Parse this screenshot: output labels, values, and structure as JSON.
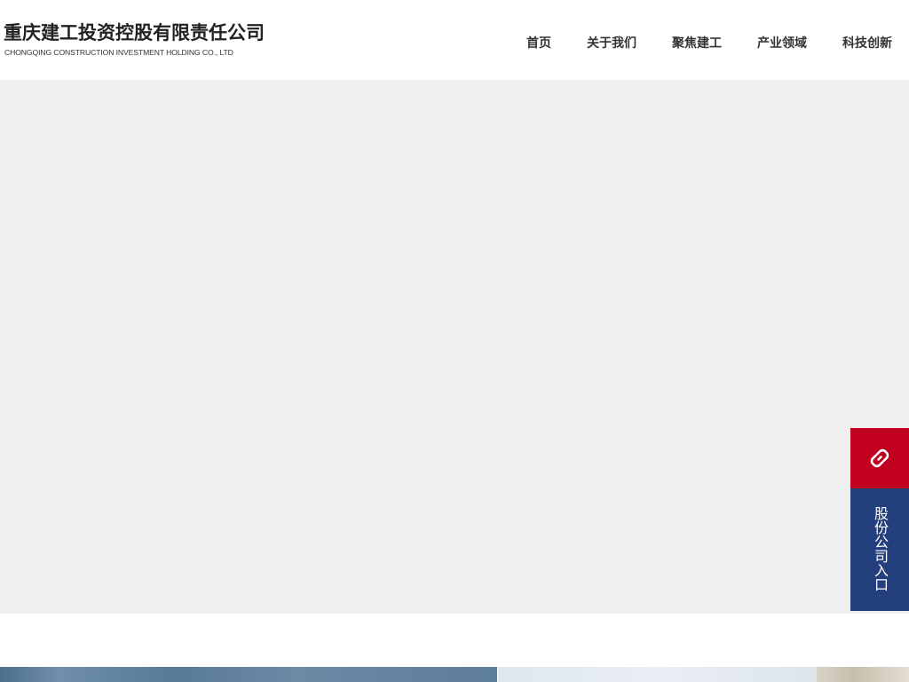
{
  "header": {
    "company_name": "重庆建工投资控股有限责任公司",
    "company_name_en": "CHONGQING CONSTRUCTION INVESTMENT HOLDING CO., LTD"
  },
  "nav": {
    "items": [
      {
        "label": "首页"
      },
      {
        "label": "关于我们"
      },
      {
        "label": "聚焦建工"
      },
      {
        "label": "产业领域"
      },
      {
        "label": "科技创新"
      }
    ]
  },
  "float_panel": {
    "link_icon": "link-icon",
    "entry_label": "股份公司入口",
    "colors": {
      "link_bg": "#c1001f",
      "entry_bg": "#243f7e"
    }
  },
  "banner": {
    "background": "#efefef"
  }
}
